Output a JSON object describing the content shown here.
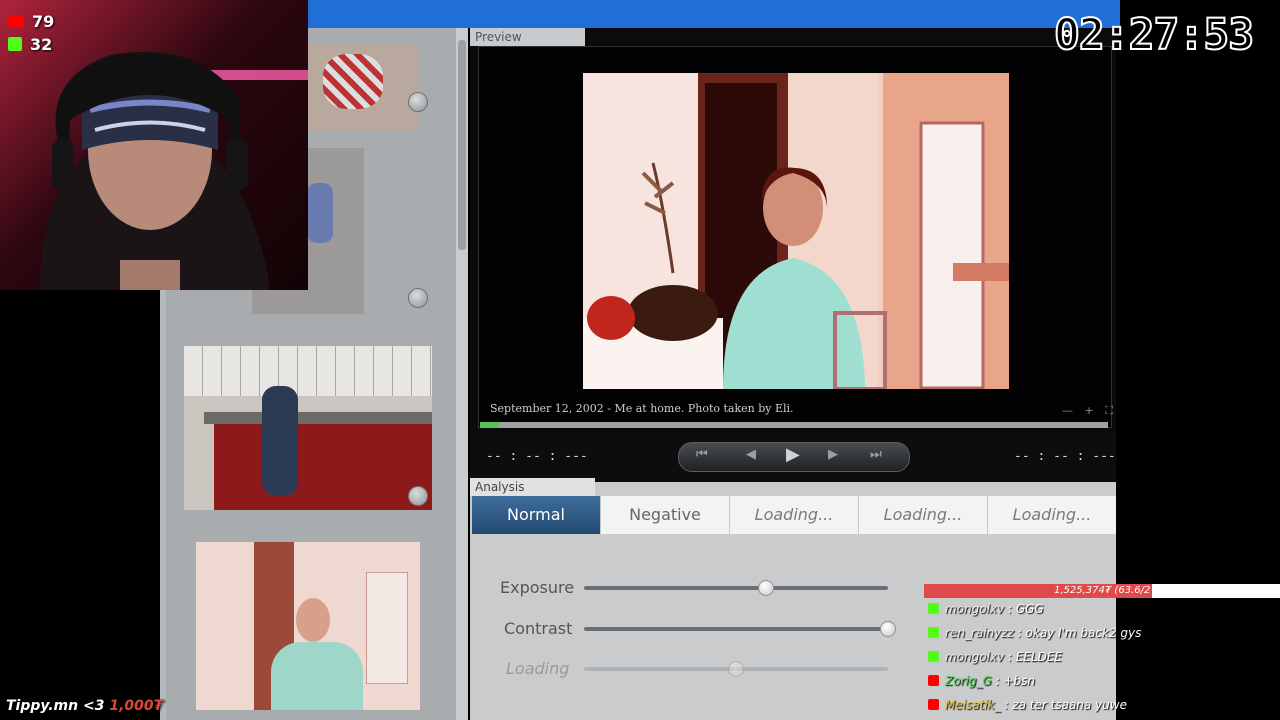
{
  "stream": {
    "youtube_viewers": "79",
    "kick_viewers": "32",
    "timer": "02:27:53",
    "tip_name": "Tippy.mn <3",
    "tip_amount": "1,000₮",
    "goal_bar_text": "1,525,374₮ (63.6/2",
    "goal_fraction": 0.64
  },
  "preview": {
    "tab_label": "Preview",
    "caption": "September 12, 2002 - Me at home. Photo taken by Eli.",
    "time_left": "-- : -- : ---",
    "time_right": "-- : -- : ---",
    "progress_fraction": 0.03
  },
  "analysis": {
    "tab_label": "Analysis",
    "mode_tabs": [
      "Normal",
      "Negative",
      "Loading...",
      "Loading...",
      "Loading..."
    ],
    "active_tab": "Normal",
    "sliders": [
      {
        "label": "Exposure",
        "value": 0.6
      },
      {
        "label": "Contrast",
        "value": 1.0
      },
      {
        "label": "Loading",
        "value": 0.5
      }
    ]
  },
  "chat": [
    {
      "platform": "kick",
      "user": "mongolxv",
      "user_color": "#e8e8e8",
      "message": "GGG"
    },
    {
      "platform": "kick",
      "user": "ren_rainyzz",
      "user_color": "#e8e8e8",
      "message": "okay I'm back2 gys"
    },
    {
      "platform": "kick",
      "user": "mongolxv",
      "user_color": "#e8e8e8",
      "message": "EELDEE"
    },
    {
      "platform": "youtube",
      "user": "Zorig_G",
      "user_color": "#58d65e",
      "message": "+bsn"
    },
    {
      "platform": "youtube",
      "user": "Meisatik_",
      "user_color": "#e0c047",
      "message": "za ter tsaana yuwe"
    }
  ]
}
